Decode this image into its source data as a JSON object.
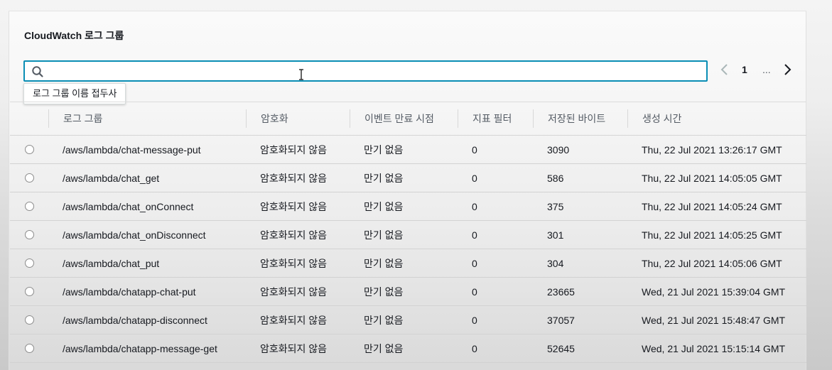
{
  "panel": {
    "title": "CloudWatch 로그 그룹"
  },
  "search": {
    "value": "",
    "placeholder": "",
    "icon": "search-icon",
    "tooltip": "로그 그룹 이름 접두사"
  },
  "pagination": {
    "current_page": "1",
    "ellipsis": "...",
    "prev_icon": "chevron-left-icon",
    "next_icon": "chevron-right-icon"
  },
  "table": {
    "columns": [
      "로그 그룹",
      "암호화",
      "이벤트 만료 시점",
      "지표 필터",
      "저장된 바이트",
      "생성 시간"
    ],
    "rows": [
      {
        "name": "/aws/lambda/chat-message-put",
        "encryption": "암호화되지 않음",
        "expiration": "만기 없음",
        "filters": "0",
        "bytes": "3090",
        "created": "Thu, 22 Jul 2021 13:26:17 GMT"
      },
      {
        "name": "/aws/lambda/chat_get",
        "encryption": "암호화되지 않음",
        "expiration": "만기 없음",
        "filters": "0",
        "bytes": "586",
        "created": "Thu, 22 Jul 2021 14:05:05 GMT"
      },
      {
        "name": "/aws/lambda/chat_onConnect",
        "encryption": "암호화되지 않음",
        "expiration": "만기 없음",
        "filters": "0",
        "bytes": "375",
        "created": "Thu, 22 Jul 2021 14:05:24 GMT"
      },
      {
        "name": "/aws/lambda/chat_onDisconnect",
        "encryption": "암호화되지 않음",
        "expiration": "만기 없음",
        "filters": "0",
        "bytes": "301",
        "created": "Thu, 22 Jul 2021 14:05:25 GMT"
      },
      {
        "name": "/aws/lambda/chat_put",
        "encryption": "암호화되지 않음",
        "expiration": "만기 없음",
        "filters": "0",
        "bytes": "304",
        "created": "Thu, 22 Jul 2021 14:05:06 GMT"
      },
      {
        "name": "/aws/lambda/chatapp-chat-put",
        "encryption": "암호화되지 않음",
        "expiration": "만기 없음",
        "filters": "0",
        "bytes": "23665",
        "created": "Wed, 21 Jul 2021 15:39:04 GMT"
      },
      {
        "name": "/aws/lambda/chatapp-disconnect",
        "encryption": "암호화되지 않음",
        "expiration": "만기 없음",
        "filters": "0",
        "bytes": "37057",
        "created": "Wed, 21 Jul 2021 15:48:47 GMT"
      },
      {
        "name": "/aws/lambda/chatapp-message-get",
        "encryption": "암호화되지 않음",
        "expiration": "만기 없음",
        "filters": "0",
        "bytes": "52645",
        "created": "Wed, 21 Jul 2021 15:15:14 GMT"
      }
    ]
  },
  "colors": {
    "focus_border": "#0a8eb5",
    "text": "#16191f",
    "header_text": "#545b64"
  }
}
